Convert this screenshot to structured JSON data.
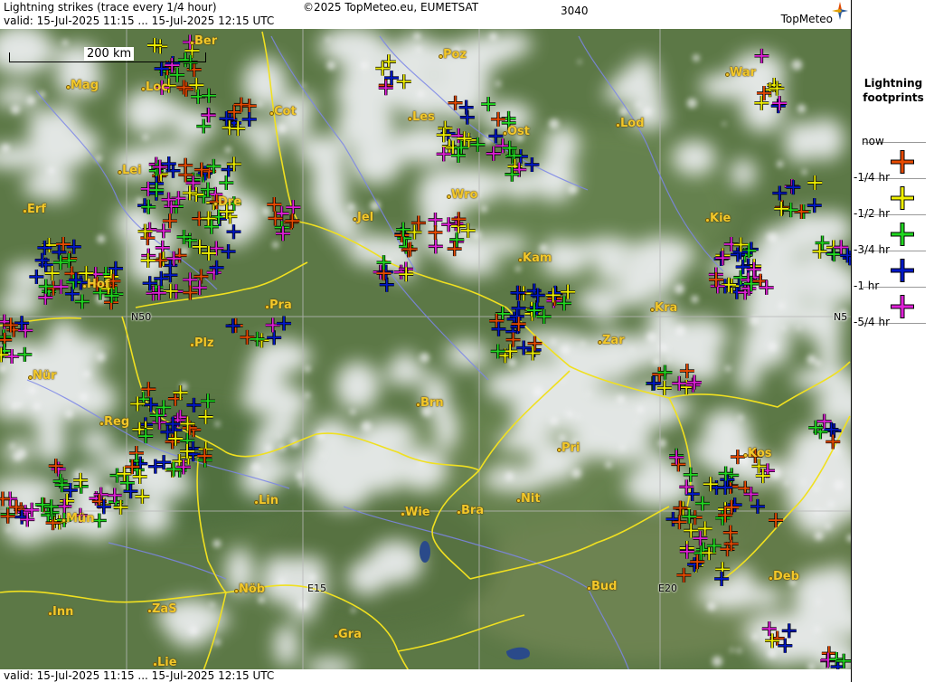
{
  "header": {
    "line1_left": "Lightning strikes (trace every 1/4 hour)",
    "copyright": "©2025 TopMeteo.eu, EUMETSAT",
    "grid_id": "3040",
    "line2_left": "valid:  15-Jul-2025 11:15 ... 15-Jul-2025 12:15 UTC",
    "brand": "TopMeteo"
  },
  "footer": {
    "valid": "valid:  15-Jul-2025 11:15 ... 15-Jul-2025 12:15 UTC"
  },
  "scale": {
    "label": "200 km"
  },
  "cities": [
    "Ber",
    "Poz",
    "War",
    "Mag",
    "Loc",
    "Cot",
    "Les",
    "Ost",
    "Lod",
    "Lei",
    "Erf",
    "Dre",
    "Jel",
    "Wro",
    "Kie",
    "Kam",
    "Hof",
    "Pra",
    "Kra",
    "Zar",
    "Plz",
    "Nür",
    "Brn",
    "Reg",
    "Kos",
    "Pri",
    "Lin",
    "Nit",
    "Wie",
    "Bra",
    "Mün",
    "Deb",
    "Bud",
    "Nöb",
    "Inn",
    "ZaS",
    "Gra",
    "Lie"
  ],
  "grid_labels": {
    "n50_left": "N50",
    "n50_right": "N5",
    "e15": "E15",
    "e20": "E20"
  },
  "legend": {
    "title": "Lightning footprints",
    "items": [
      {
        "label": "now",
        "color": "#e84a00"
      },
      {
        "label": "-1/4 hr",
        "color": "#f0f000"
      },
      {
        "label": "-1/2 hr",
        "color": "#20d820"
      },
      {
        "label": "-3/4 hr",
        "color": "#0018c8"
      },
      {
        "label": "-1 hr",
        "color": "#e020d8"
      },
      {
        "label": "-5/4 hr",
        "color": ""
      }
    ]
  },
  "colors": {
    "border": "#f0e020",
    "river": "#7080e0",
    "grid": "#b0b0b0",
    "city_label": "#f3c82a"
  }
}
